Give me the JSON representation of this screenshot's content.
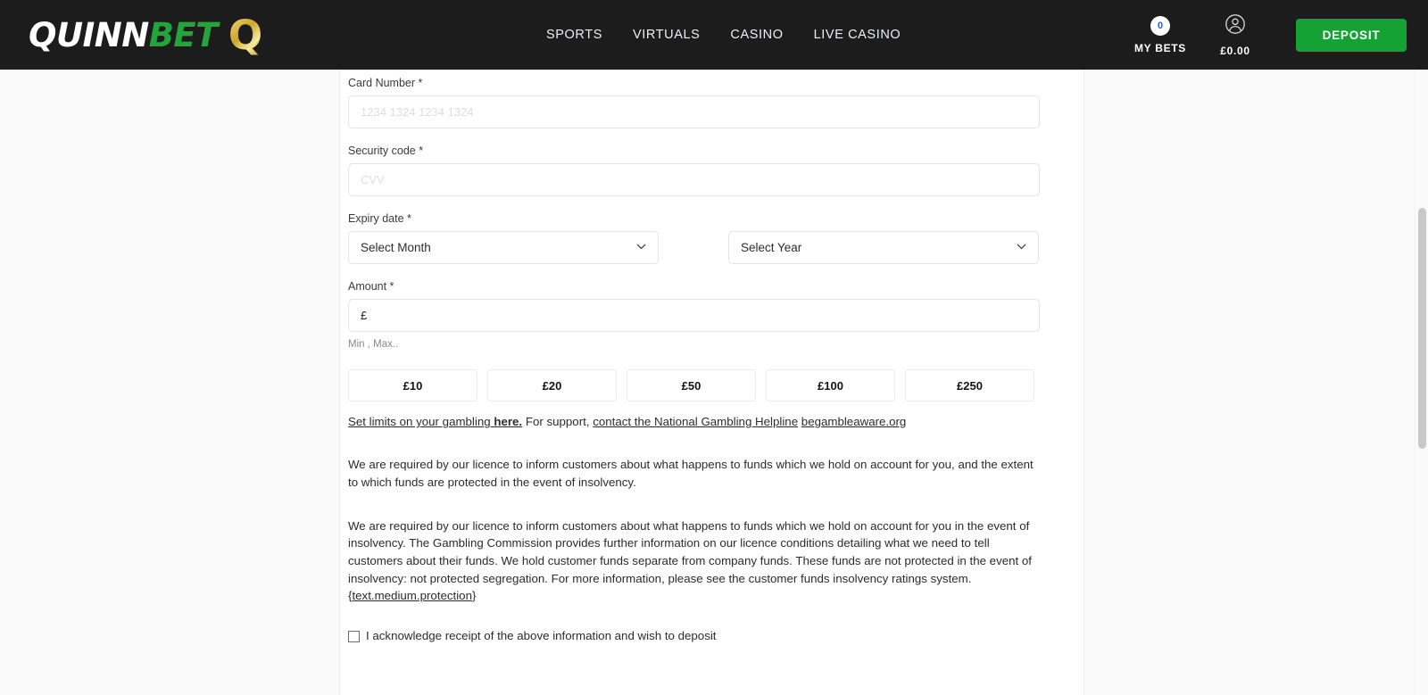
{
  "header": {
    "brand": {
      "part1": "QUINN",
      "part2": "BET",
      "mark": "Q"
    },
    "nav": [
      {
        "label": "SPORTS"
      },
      {
        "label": "VIRTUALS"
      },
      {
        "label": "CASINO"
      },
      {
        "label": "LIVE CASINO"
      }
    ],
    "my_bets": {
      "count": "0",
      "label": "MY BETS",
      "badge_text_color": "#1565d8",
      "badge_bg": "#ffffff"
    },
    "account": {
      "balance": "£0.00",
      "icon": "user-avatar-icon"
    },
    "deposit_button": {
      "label": "DEPOSIT",
      "color": "#16a134"
    },
    "background": "#1c1c1c"
  },
  "form": {
    "card_number": {
      "label": "Card Number *",
      "placeholder": "1234 1324 1234 1324",
      "value": ""
    },
    "security_code": {
      "label": "Security code *",
      "placeholder": "CVV",
      "value": ""
    },
    "expiry": {
      "label": "Expiry date *",
      "month": {
        "selected": "Select Month",
        "icon": "chevron-down-icon"
      },
      "year": {
        "selected": "Select Year",
        "icon": "chevron-down-icon"
      }
    },
    "amount": {
      "label": "Amount *",
      "value": "£",
      "helper": "Min , Max.."
    },
    "quick_amounts": [
      {
        "label": "£10"
      },
      {
        "label": "£20"
      },
      {
        "label": "£50"
      },
      {
        "label": "£100"
      },
      {
        "label": "£250"
      }
    ]
  },
  "support": {
    "limits_link": "Set limits on your gambling ",
    "limits_link_bold": "here.",
    "middle_text": " For support, ",
    "helpline_link": "contact the National Gambling Helpline",
    "spacer": " ",
    "begambleaware_link": "begambleaware.org"
  },
  "paragraphs": {
    "p1": "We are required by our licence to inform customers about what happens to funds which we hold on account for you, and the extent to which funds are protected in the event of insolvency.",
    "p2_before": "We are required by our licence to inform customers about what happens to funds which we hold on account for you in the event of insolvency. The Gambling Commission provides further information on our licence conditions detailing what we need to tell customers about their funds. We hold customer funds separate from company funds. These funds are not protected in the event of insolvency: not protected segregation. For more information, please see the customer funds insolvency ratings system.{",
    "p2_link": "text.medium.protection",
    "p2_after": "}"
  },
  "acknowledge": {
    "label": "I acknowledge receipt of the above information and wish to deposit",
    "checked": false
  },
  "scrollbar": {
    "name": "vertical-scrollbar"
  }
}
